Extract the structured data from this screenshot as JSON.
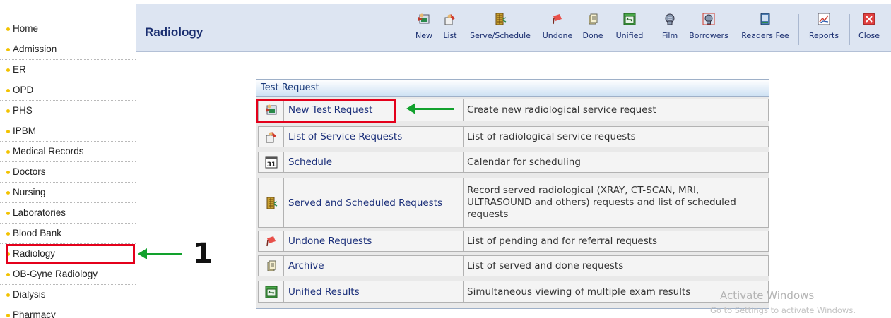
{
  "sidebar": {
    "items": [
      {
        "label": "Home"
      },
      {
        "label": "Admission"
      },
      {
        "label": "ER"
      },
      {
        "label": "OPD"
      },
      {
        "label": "PHS"
      },
      {
        "label": "IPBM"
      },
      {
        "label": "Medical Records"
      },
      {
        "label": "Doctors"
      },
      {
        "label": "Nursing"
      },
      {
        "label": "Laboratories"
      },
      {
        "label": "Blood Bank"
      },
      {
        "label": "Radiology"
      },
      {
        "label": "OB-Gyne Radiology"
      },
      {
        "label": "Dialysis"
      },
      {
        "label": "Pharmacy"
      }
    ]
  },
  "header": {
    "title": "Radiology",
    "tools": [
      {
        "label": "New",
        "icon": "new-request-icon"
      },
      {
        "label": "List",
        "icon": "list-icon"
      },
      {
        "label": "Serve/Schedule",
        "icon": "serve-schedule-icon"
      },
      {
        "label": "Undone",
        "icon": "undone-flag-icon"
      },
      {
        "label": "Done",
        "icon": "done-icon"
      },
      {
        "label": "Unified",
        "icon": "unified-icon"
      },
      {
        "label": "Film",
        "icon": "film-icon"
      },
      {
        "label": "Borrowers",
        "icon": "borrowers-icon"
      },
      {
        "label": "Readers Fee",
        "icon": "readers-fee-icon"
      },
      {
        "label": "Reports",
        "icon": "reports-chart-icon"
      },
      {
        "label": "Close",
        "icon": "close-icon"
      }
    ]
  },
  "panel": {
    "title": "Test Request",
    "rows": [
      {
        "name": "New Test Request",
        "description": "Create new radiological service request",
        "icon": "new-request-icon"
      },
      {
        "name": "List of Service Requests",
        "description": "List of radiological service requests",
        "icon": "list-icon"
      },
      {
        "name": "Schedule",
        "description": "Calendar for scheduling",
        "icon": "calendar-icon",
        "icon_text": "31"
      },
      {
        "name": "Served and Scheduled Requests",
        "description": "Record served radiological (XRAY, CT-SCAN, MRI, ULTRASOUND and others) requests and list of scheduled requests",
        "icon": "serve-schedule-icon"
      },
      {
        "name": "Undone Requests",
        "description": "List of pending and for referral requests",
        "icon": "undone-flag-icon"
      },
      {
        "name": "Archive",
        "description": "List of served and done requests",
        "icon": "archive-icon"
      },
      {
        "name": "Unified Results",
        "description": "Simultaneous viewing of multiple exam results",
        "icon": "unified-icon"
      }
    ]
  },
  "annotations": {
    "step_number": "1"
  },
  "watermark": {
    "line1": "Activate Windows",
    "line2": "Go to Settings to activate Windows."
  },
  "colors": {
    "header_bg": "#dde5f2",
    "title_blue": "#1a2e70",
    "highlight_red": "#e4001b",
    "arrow_green": "#12a12d",
    "bullet_yellow": "#f2c200"
  }
}
